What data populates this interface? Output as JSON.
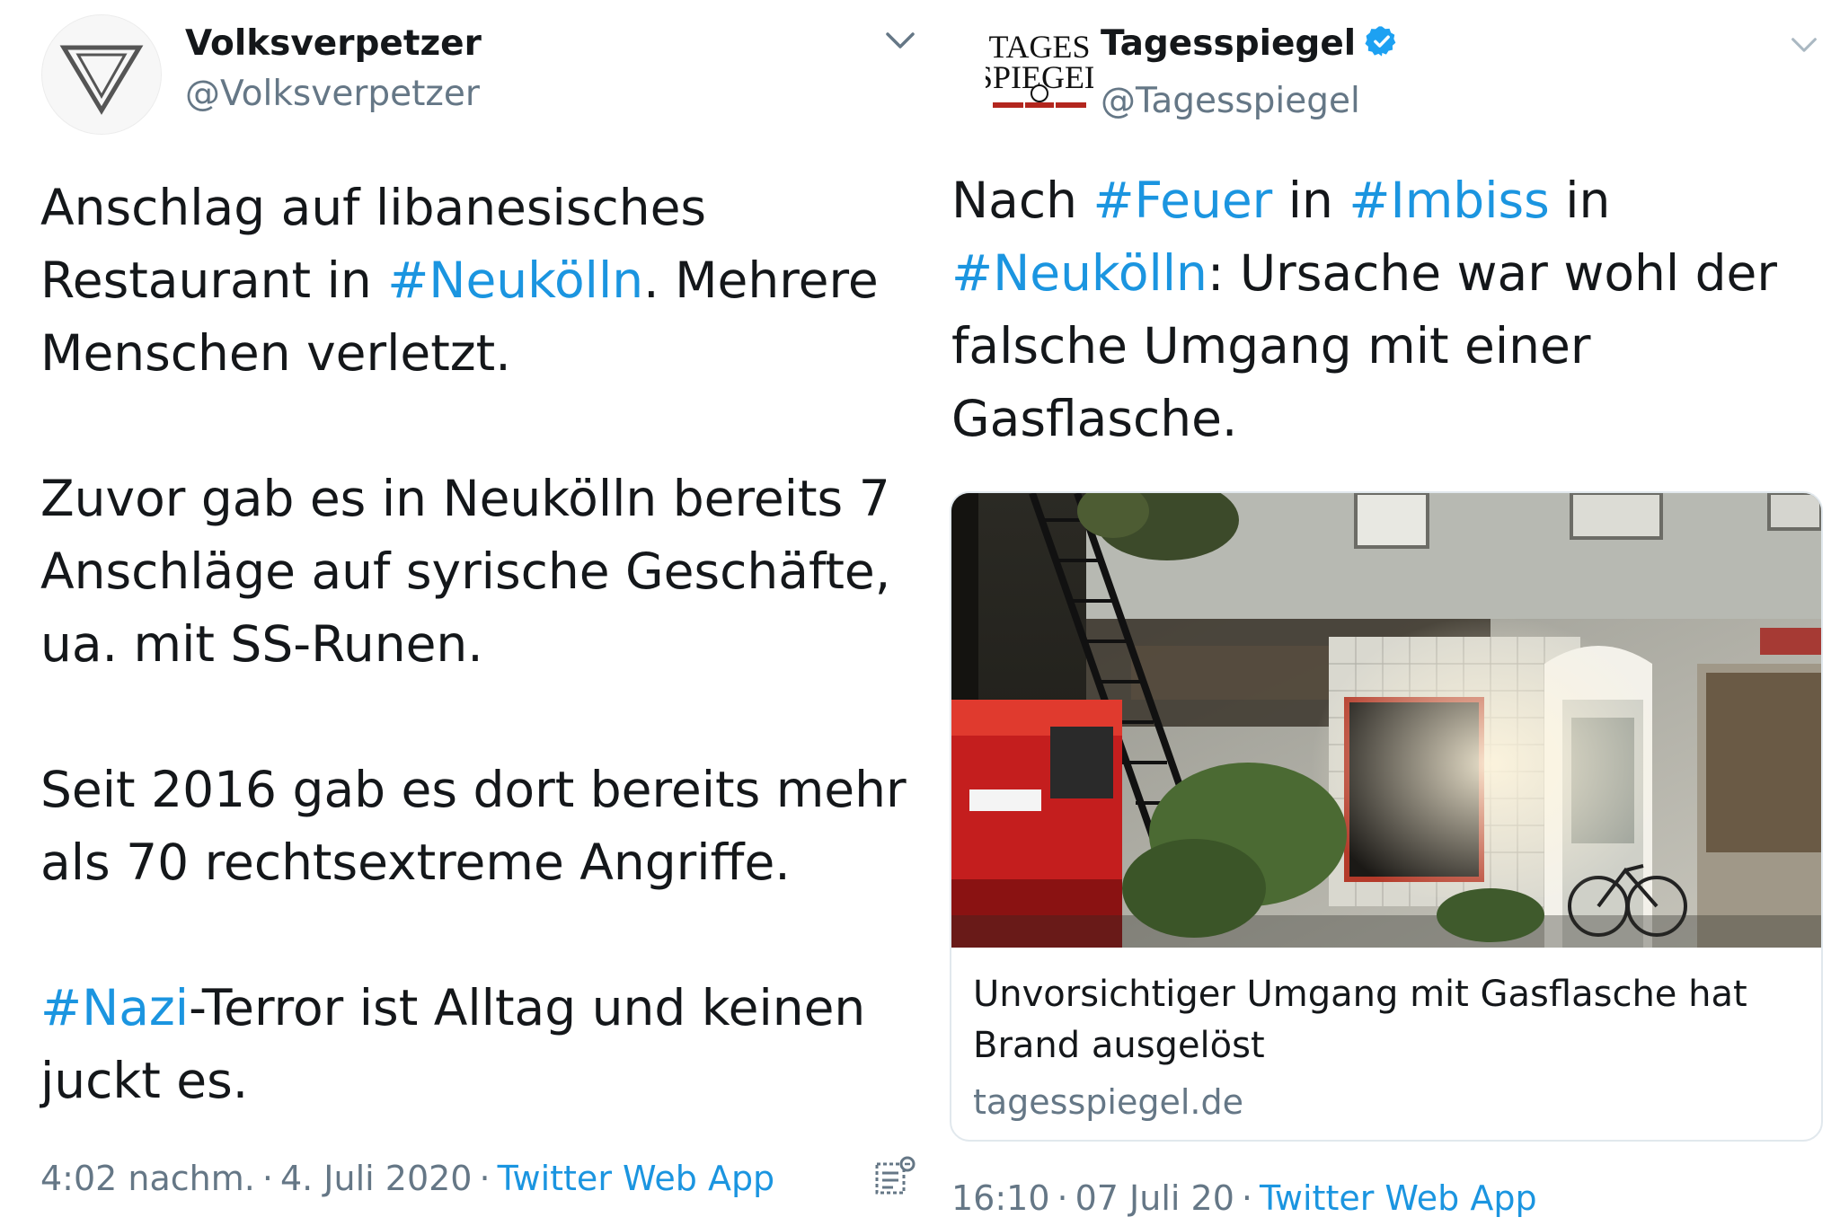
{
  "left_tweet": {
    "display_name": "Volksverpetzer",
    "handle": "@Volksverpetzer",
    "paragraphs": [
      [
        {
          "t": "Anschlag auf libanesisches Restaurant in "
        },
        {
          "t": "#Neukölln",
          "tag": true
        },
        {
          "t": ". Mehrere Menschen verletzt."
        }
      ],
      [
        {
          "t": "Zuvor gab es in Neukölln bereits 7 Anschläge auf syrische Geschäfte, ua. mit SS-Runen."
        }
      ],
      [
        {
          "t": "Seit 2016 gab es dort bereits mehr als 70 rechtsextreme Angriffe."
        }
      ],
      [
        {
          "t": "#Nazi",
          "tag": true
        },
        {
          "t": "-Terror ist Alltag und keinen juckt es."
        }
      ]
    ],
    "time": "4:02 nachm.",
    "date": "4. Juli 2020",
    "separator": "·",
    "source_app": "Twitter Web App"
  },
  "right_tweet": {
    "display_name": "Tagesspiegel",
    "handle": "@Tagesspiegel",
    "logo_text_line1": "TAGES",
    "logo_text_line2": "SPIEGEL",
    "paragraphs": [
      [
        {
          "t": "Nach "
        },
        {
          "t": "#Feuer",
          "tag": true
        },
        {
          "t": " in "
        },
        {
          "t": "#Imbiss",
          "tag": true
        },
        {
          "t": " in "
        },
        {
          "t": "#Neukölln",
          "tag": true
        },
        {
          "t": ": Ursache war wohl der falsche Umgang mit einer Gasflasche."
        }
      ]
    ],
    "card": {
      "title": "Unvorsichtiger Umgang mit Gasflasche hat Brand ausgelöst",
      "domain": "tagesspiegel.de"
    },
    "time": "16:10",
    "date": "07 Juli 20",
    "separator": "·",
    "source_app": "Twitter Web App"
  },
  "colors": {
    "hashtag": "#1b95e0",
    "text": "#14171a",
    "secondary": "#657786",
    "verified": "#1da1f2"
  },
  "icons": [
    "triangle-logo-icon",
    "chevron-down-icon",
    "verified-badge-icon",
    "analytics-icon",
    "tagesspiegel-logo-icon"
  ]
}
